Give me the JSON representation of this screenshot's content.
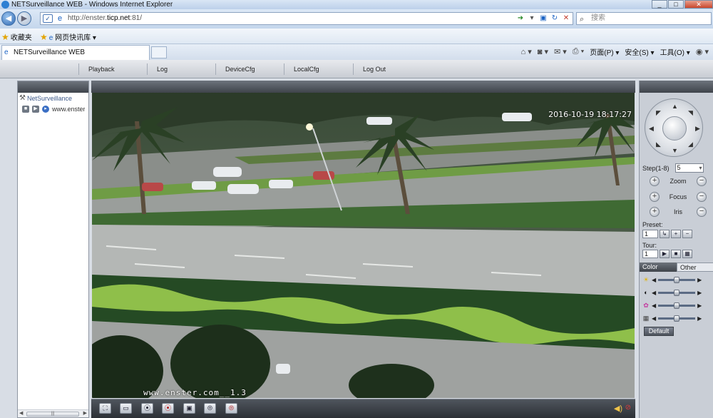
{
  "window": {
    "title": "NETSurveillance WEB - Windows Internet Explorer",
    "controls": [
      "_",
      "□",
      "✕"
    ]
  },
  "browser": {
    "url_prefix": "http://enster.",
    "url_host": "ticp.net",
    "url_suffix": ":81/",
    "search_placeholder": "搜索",
    "favorites_label": "收藏夹",
    "quicklink_label": "网页快讯库 ▾",
    "tab_label": "NETSurveillance WEB",
    "commands": [
      "页面(P) ▾",
      "安全(S) ▾",
      "工具(O) ▾"
    ]
  },
  "nav": {
    "items": [
      "Playback",
      "Log",
      "DeviceCfg",
      "LocalCfg",
      "Log Out"
    ]
  },
  "device_tree": {
    "root_label": "NetSurveillance",
    "device_label": "www.enster"
  },
  "video": {
    "timestamp": "2016-10-19 18:17:27",
    "watermark": "www.enster.com__1.3"
  },
  "ptz": {
    "step_label": "Step(1-8)",
    "step_value": "5",
    "zoom_label": "Zoom",
    "focus_label": "Focus",
    "iris_label": "Iris",
    "preset_label": "Preset:",
    "preset_value": "1",
    "tour_label": "Tour:",
    "tour_value": "1"
  },
  "color_panel": {
    "tab_color": "Color",
    "tab_other": "Other",
    "sliders": [
      {
        "icon": "brightness-icon",
        "level": 0.5
      },
      {
        "icon": "contrast-icon",
        "level": 0.5
      },
      {
        "icon": "saturation-icon",
        "level": 0.5
      },
      {
        "icon": "hue-icon",
        "level": 0.5
      }
    ],
    "default_label": "Default"
  },
  "colors": {
    "panel_dark": "#3f444b",
    "road": "#7d8280",
    "hedge": "#7fb04a",
    "grass": "#2f5a2c"
  }
}
